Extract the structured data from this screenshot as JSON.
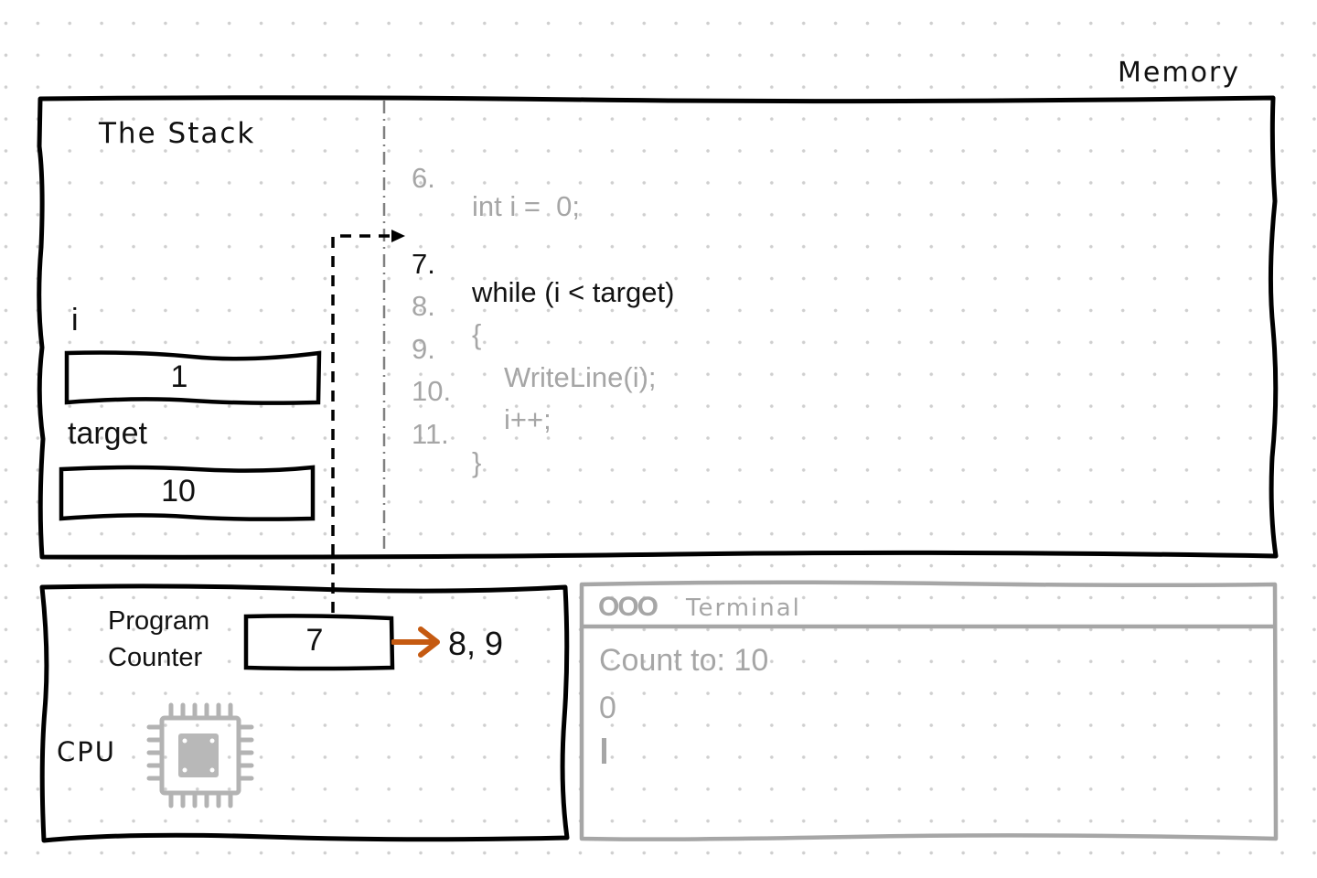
{
  "memory": {
    "title": "Memory"
  },
  "stack": {
    "title": "The Stack",
    "variables": [
      {
        "name": "i",
        "value": "1"
      },
      {
        "name": "target",
        "value": "10"
      }
    ]
  },
  "code": {
    "current_line": "7",
    "lines": [
      {
        "num": "6.",
        "text": "int i =  0;",
        "active": false
      },
      {
        "num": "7.",
        "text": "while (i < target)",
        "active": true
      },
      {
        "num": "8.",
        "text": "{",
        "active": false
      },
      {
        "num": "9.",
        "text": "WriteLine(i);",
        "active": false
      },
      {
        "num": "10.",
        "text": "i++;",
        "active": false
      },
      {
        "num": "11.",
        "text": "}",
        "active": false
      }
    ]
  },
  "cpu": {
    "label": "CPU",
    "program_counter_label_line1": "Program",
    "program_counter_label_line2": "Counter",
    "program_counter_value": "7",
    "next_lines": "8, 9",
    "arrow_color": "#c55a11"
  },
  "terminal": {
    "title": "Terminal",
    "window_buttons": "OOO",
    "lines": [
      "Count to: 10",
      "0"
    ],
    "cursor": "I"
  }
}
